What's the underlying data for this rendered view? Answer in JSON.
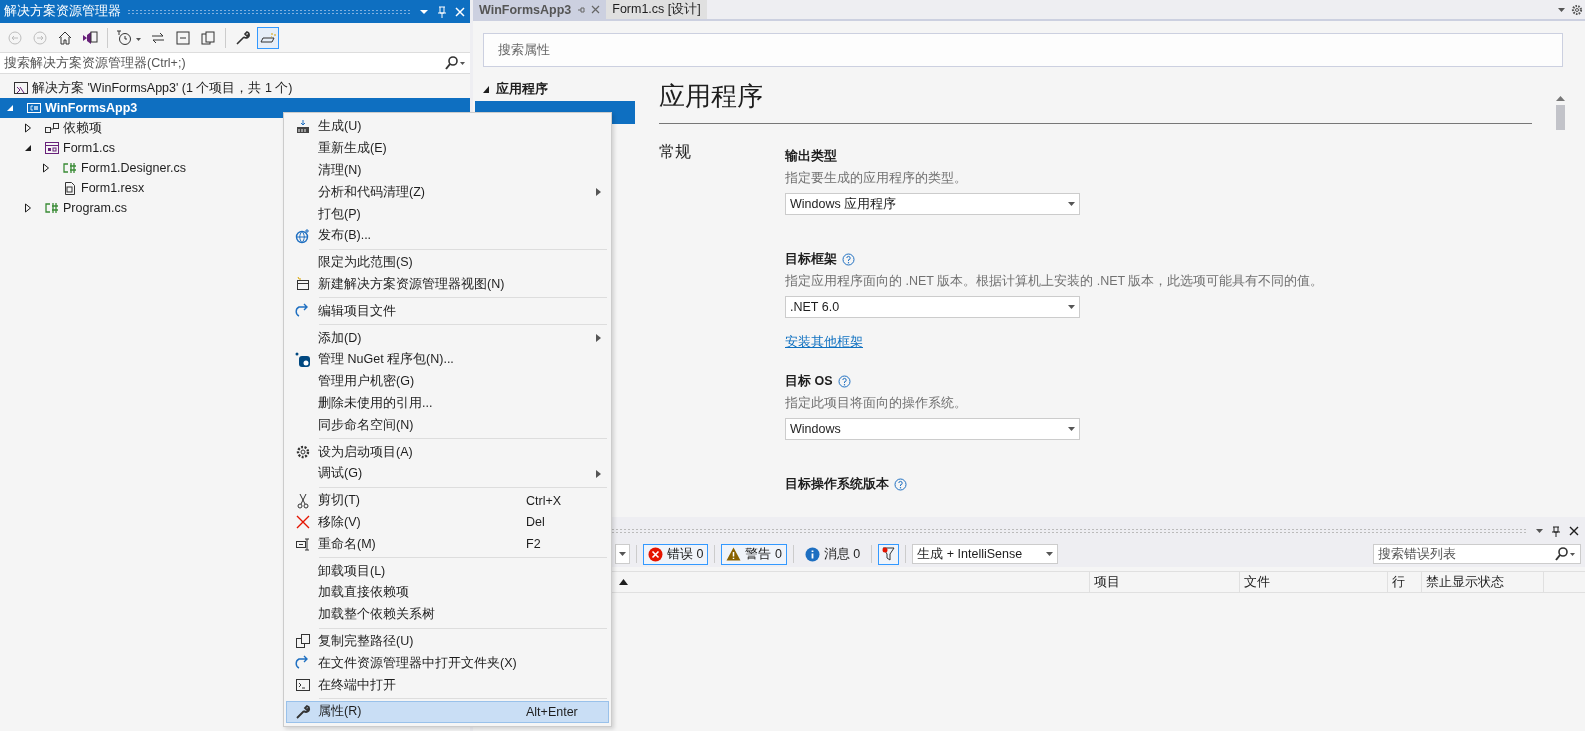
{
  "solution_explorer": {
    "title": "解决方案资源管理器",
    "toolbar": [
      {
        "kind": "back",
        "disabled": true,
        "selected": false
      },
      {
        "kind": "forward",
        "disabled": true,
        "selected": false
      },
      {
        "kind": "home",
        "disabled": false,
        "selected": false
      },
      {
        "kind": "switch-view",
        "disabled": false,
        "selected": false
      },
      {
        "kind": "pending",
        "disabled": false,
        "selected": false
      },
      {
        "kind": "sync",
        "disabled": false,
        "selected": false
      },
      {
        "kind": "collapse",
        "disabled": false,
        "selected": false
      },
      {
        "kind": "show-all",
        "disabled": false,
        "selected": false
      },
      {
        "kind": "properties",
        "disabled": false,
        "selected": false
      },
      {
        "kind": "preview",
        "disabled": false,
        "selected": true
      }
    ],
    "search": {
      "placeholder": "搜索解决方案资源管理器(Ctrl+;)"
    },
    "tree": [
      {
        "label": "解决方案 'WinFormsApp3' (1 个项目，共 1 个)",
        "kind": "solution",
        "selected": false,
        "children": [
          {
            "label": "WinFormsApp3",
            "kind": "project",
            "expanded": true,
            "selected": true,
            "children": [
              {
                "label": "依赖项",
                "kind": "deps",
                "expanded": false,
                "selected": false
              },
              {
                "label": "Form1.cs",
                "kind": "form",
                "expanded": true,
                "selected": false,
                "children": [
                  {
                    "label": "Form1.Designer.cs",
                    "kind": "cs",
                    "expanded": false,
                    "selected": false
                  },
                  {
                    "label": "Form1.resx",
                    "kind": "resx",
                    "selected": false
                  }
                ]
              },
              {
                "label": "Program.cs",
                "kind": "cs",
                "expanded": false,
                "selected": false
              }
            ]
          }
        ]
      }
    ]
  },
  "doc_tabs": [
    {
      "label": "WinFormsApp3",
      "selected": true
    },
    {
      "label": "Form1.cs [设计]",
      "selected": false
    }
  ],
  "properties": {
    "search": {
      "placeholder": "搜索属性"
    },
    "nav": [
      {
        "label": "应用程序",
        "expanded": true,
        "children": [
          {
            "selected": true
          }
        ]
      }
    ],
    "heading": "应用程序",
    "section": "常规",
    "fields": [
      {
        "kind": "select",
        "label": "输出类型",
        "help": false,
        "description": "指定要生成的应用程序的类型。",
        "value": "Windows 应用程序"
      },
      {
        "kind": "select",
        "label": "目标框架",
        "help": true,
        "description": "指定应用程序面向的 .NET 版本。根据计算机上安装的 .NET 版本，此选项可能具有不同的值。",
        "value": ".NET 6.0"
      },
      {
        "kind": "link",
        "label": "安装其他框架"
      },
      {
        "kind": "select",
        "label": "目标 OS",
        "help": true,
        "description": "指定此项目将面向的操作系统。",
        "value": "Windows"
      },
      {
        "kind": "text",
        "label": "目标操作系统版本",
        "help": true
      }
    ]
  },
  "error_list": {
    "filters": [
      {
        "kind": "error",
        "label": "错误 0",
        "selected": true
      },
      {
        "kind": "warning",
        "label": "警告 0",
        "selected": true
      },
      {
        "kind": "message",
        "label": "消息 0",
        "selected": false
      }
    ],
    "filter_toggle": {
      "selected": true
    },
    "source": "生成 + IntelliSense",
    "search": {
      "placeholder": "搜索错误列表"
    },
    "columns": [
      {
        "sorted": true
      },
      {
        "label": "项目",
        "sorted": false
      },
      {
        "label": "文件",
        "sorted": false
      },
      {
        "label": "行",
        "sorted": false
      },
      {
        "label": "禁止显示状态",
        "sorted": false
      }
    ]
  },
  "context_menu": [
    {
      "kind": "build",
      "label": "生成(U)",
      "submenu": false,
      "selected": false
    },
    {
      "kind": "plain",
      "label": "重新生成(E)",
      "submenu": false,
      "selected": false
    },
    {
      "kind": "plain",
      "label": "清理(N)",
      "submenu": false,
      "selected": false
    },
    {
      "kind": "plain",
      "label": "分析和代码清理(Z)",
      "submenu": true,
      "selected": false
    },
    {
      "kind": "plain",
      "label": "打包(P)",
      "submenu": false,
      "selected": false
    },
    {
      "kind": "publish",
      "label": "发布(B)...",
      "submenu": false,
      "selected": false
    },
    {
      "kind": "separator"
    },
    {
      "kind": "plain",
      "label": "限定为此范围(S)",
      "submenu": false,
      "selected": false
    },
    {
      "kind": "new-view",
      "label": "新建解决方案资源管理器视图(N)",
      "submenu": false,
      "selected": false
    },
    {
      "kind": "separator"
    },
    {
      "kind": "edit",
      "label": "编辑项目文件",
      "submenu": false,
      "selected": false
    },
    {
      "kind": "separator"
    },
    {
      "kind": "plain",
      "label": "添加(D)",
      "submenu": true,
      "selected": false
    },
    {
      "kind": "nuget",
      "label": "管理 NuGet 程序包(N)...",
      "submenu": false,
      "selected": false
    },
    {
      "kind": "plain",
      "label": "管理用户机密(G)",
      "submenu": false,
      "selected": false
    },
    {
      "kind": "plain",
      "label": "删除未使用的引用...",
      "submenu": false,
      "selected": false
    },
    {
      "kind": "plain",
      "label": "同步命名空间(N)",
      "submenu": false,
      "selected": false
    },
    {
      "kind": "separator"
    },
    {
      "kind": "startup",
      "label": "设为启动项目(A)",
      "submenu": false,
      "selected": false
    },
    {
      "kind": "plain",
      "label": "调试(G)",
      "submenu": true,
      "selected": false
    },
    {
      "kind": "separator"
    },
    {
      "kind": "cut",
      "label": "剪切(T)",
      "shortcut": "Ctrl+X",
      "submenu": false,
      "selected": false
    },
    {
      "kind": "remove",
      "label": "移除(V)",
      "shortcut": "Del",
      "submenu": false,
      "selected": false
    },
    {
      "kind": "rename",
      "label": "重命名(M)",
      "shortcut": "F2",
      "submenu": false,
      "selected": false
    },
    {
      "kind": "separator"
    },
    {
      "kind": "plain",
      "label": "卸载项目(L)",
      "submenu": false,
      "selected": false
    },
    {
      "kind": "plain",
      "label": "加载直接依赖项",
      "submenu": false,
      "selected": false
    },
    {
      "kind": "plain",
      "label": "加载整个依赖关系树",
      "submenu": false,
      "selected": false
    },
    {
      "kind": "separator"
    },
    {
      "kind": "copy",
      "label": "复制完整路径(U)",
      "submenu": false,
      "selected": false
    },
    {
      "kind": "open-folder",
      "label": "在文件资源管理器中打开文件夹(X)",
      "submenu": false,
      "selected": false
    },
    {
      "kind": "terminal",
      "label": "在终端中打开",
      "submenu": false,
      "selected": false
    },
    {
      "kind": "separator"
    },
    {
      "kind": "properties",
      "label": "属性(R)",
      "shortcut": "Alt+Enter",
      "submenu": false,
      "selected": true
    }
  ]
}
